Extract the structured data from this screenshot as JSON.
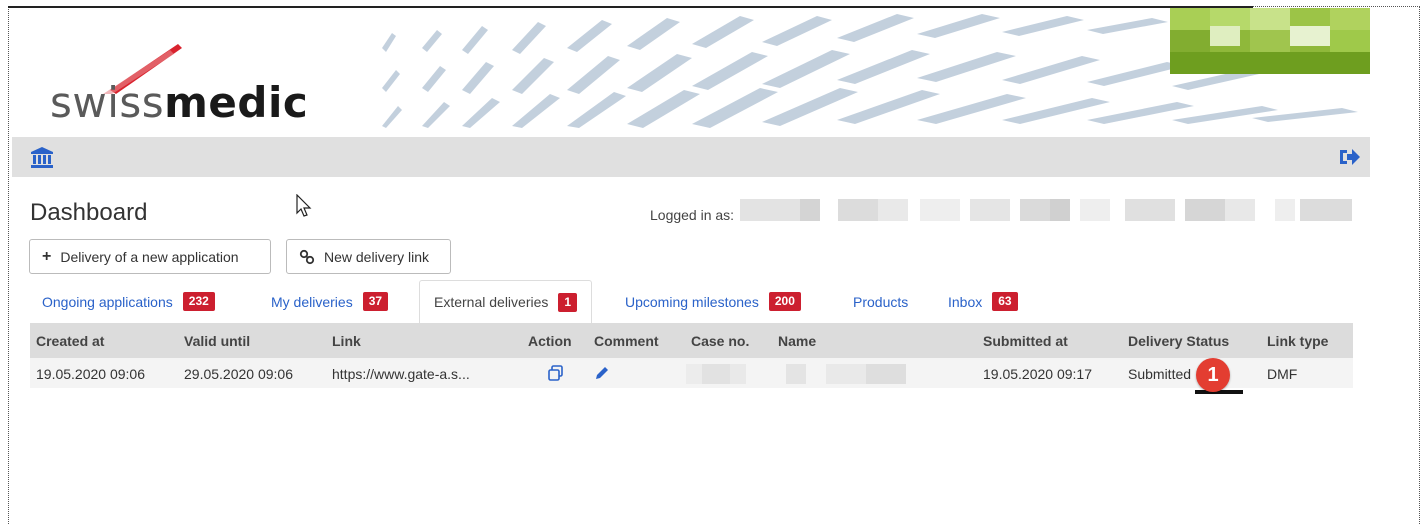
{
  "brand": {
    "logo_light": "swiss",
    "logo_bold": "medic"
  },
  "navbar": {
    "home_icon": "institution-icon",
    "logout_icon": "sign-out-icon",
    "accent": "#2a62c9"
  },
  "page": {
    "title": "Dashboard",
    "logged_in_label": "Logged in as:"
  },
  "actions": {
    "new_application": "Delivery of a new application",
    "new_link": "New delivery link"
  },
  "tabs": [
    {
      "label": "Ongoing applications",
      "count": "232"
    },
    {
      "label": "My deliveries",
      "count": "37"
    },
    {
      "label": "External deliveries",
      "count": "1",
      "active": true
    },
    {
      "label": "Upcoming milestones",
      "count": "200"
    },
    {
      "label": "Products",
      "count": ""
    },
    {
      "label": "Inbox",
      "count": "63"
    }
  ],
  "table": {
    "columns": [
      "Created at",
      "Valid until",
      "Link",
      "Action",
      "Comment",
      "Case no.",
      "Name",
      "Submitted at",
      "Delivery Status",
      "Link type"
    ],
    "rows": [
      {
        "created_at": "19.05.2020 09:06",
        "valid_until": "29.05.2020 09:06",
        "link": "https://www.gate-a.s...",
        "submitted_at": "19.05.2020 09:17",
        "status": "Submitted",
        "link_type": "DMF"
      }
    ]
  },
  "annotation": {
    "number": "1",
    "color": "#e33d31"
  }
}
